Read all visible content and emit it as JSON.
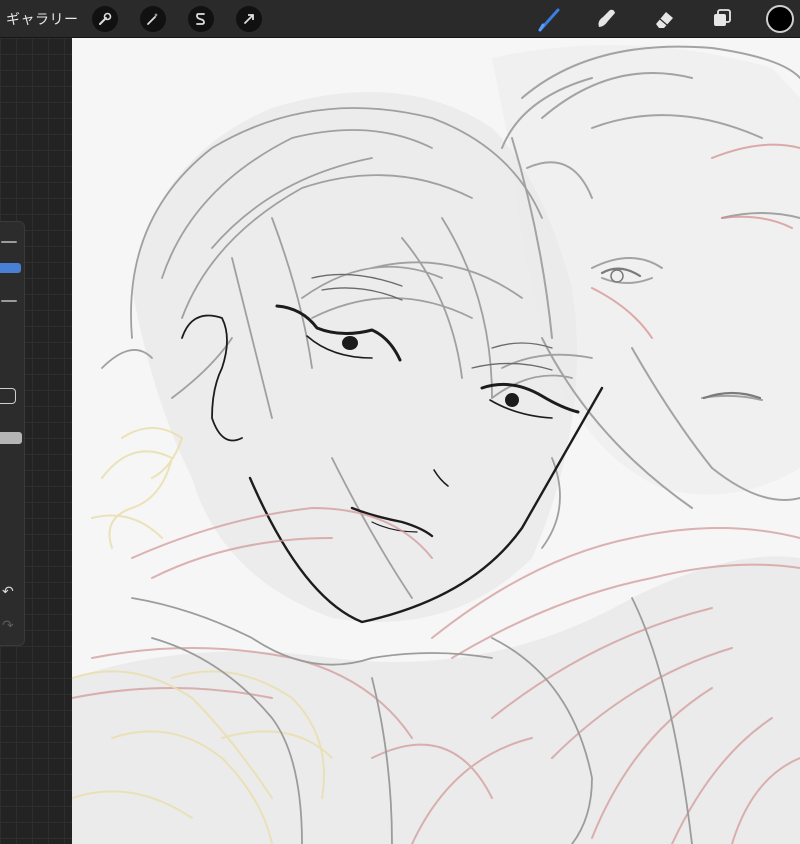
{
  "toolbar": {
    "gallery_label": "ギャラリー",
    "left_tools": [
      {
        "name": "actions",
        "icon": "wrench-icon"
      },
      {
        "name": "adjustments",
        "icon": "magic-wand-icon"
      },
      {
        "name": "selection",
        "icon": "selection-s-icon"
      },
      {
        "name": "transform",
        "icon": "transform-arrow-icon"
      }
    ],
    "right_tools": [
      {
        "name": "brush",
        "icon": "brush-icon",
        "active": true
      },
      {
        "name": "smudge",
        "icon": "smudge-icon",
        "active": false
      },
      {
        "name": "eraser",
        "icon": "eraser-icon",
        "active": false
      },
      {
        "name": "layers",
        "icon": "layers-icon",
        "active": false
      }
    ],
    "current_color": "#000000",
    "accent_color": "#3b7de0"
  },
  "sidebar": {
    "brush_size_active": true,
    "undo_icon": "undo-icon",
    "redo_icon": "redo-icon"
  },
  "canvas": {
    "content": "sketch-artwork",
    "background_color": "#f6f6f6",
    "stroke_colors": [
      "#1a1a1a",
      "#9a9a9a",
      "#d9a6a6",
      "#efe3b4"
    ]
  }
}
